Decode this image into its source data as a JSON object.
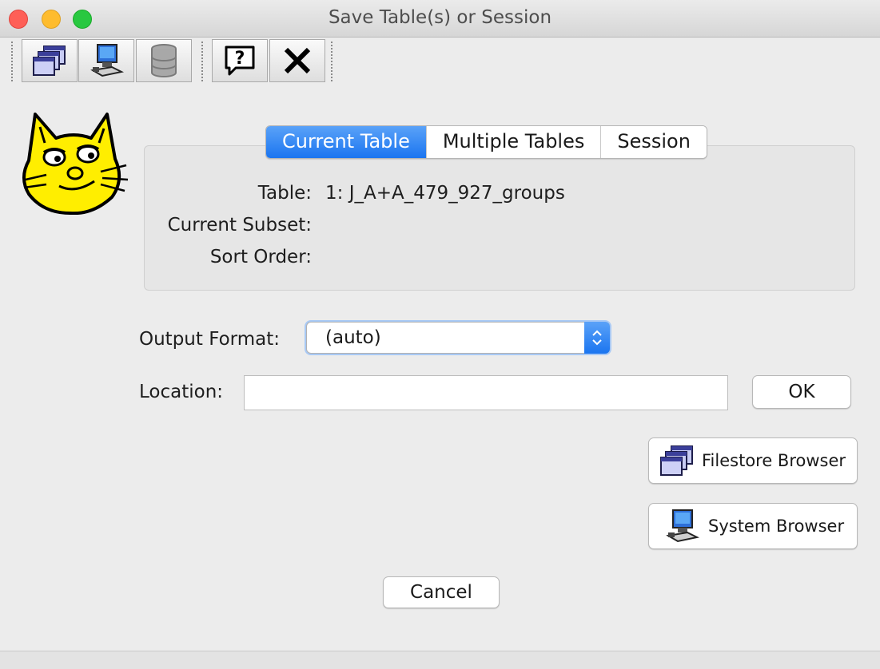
{
  "window": {
    "title": "Save Table(s) or Session"
  },
  "toolbar": {
    "buttons": [
      {
        "name": "filestore-icon"
      },
      {
        "name": "system-browser-icon"
      },
      {
        "name": "database-icon"
      },
      {
        "name": "help-icon"
      },
      {
        "name": "close-icon"
      }
    ]
  },
  "tabs": [
    {
      "label": "Current Table",
      "active": true
    },
    {
      "label": "Multiple Tables",
      "active": false
    },
    {
      "label": "Session",
      "active": false
    }
  ],
  "current_table": {
    "table_label": "Table:",
    "table_value": "1: J_A+A_479_927_groups",
    "subset_label": "Current Subset:",
    "subset_value": "",
    "sort_label": "Sort Order:",
    "sort_value": ""
  },
  "output_format": {
    "label": "Output Format:",
    "value": "(auto)"
  },
  "location": {
    "label": "Location:",
    "value": "",
    "placeholder": ""
  },
  "buttons": {
    "ok": "OK",
    "filestore_browser": "Filestore Browser",
    "system_browser": "System Browser",
    "cancel": "Cancel"
  },
  "colors": {
    "accent": "#1b75f0",
    "logo": "#ffee00"
  }
}
